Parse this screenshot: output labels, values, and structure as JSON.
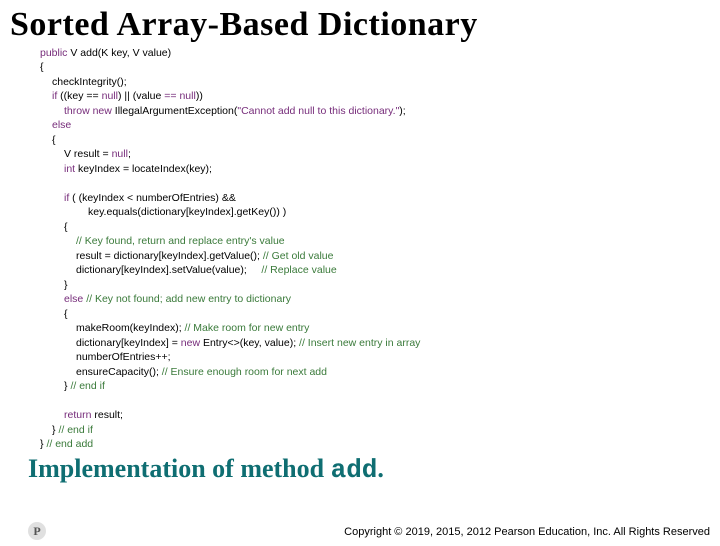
{
  "title": "Sorted Array-Based Dictionary",
  "code": {
    "l1a": "public",
    "l1b": " V add(K key, V value)",
    "l2": "{",
    "l3": "checkIntegrity();",
    "l4a": "if",
    "l4b": " ((key == ",
    "l4c": "null",
    "l4d": ") || (value ",
    "l4e": "==",
    "l4f": " ",
    "l4g": "null",
    "l4h": "))",
    "l5a": "throw new ",
    "l5b": "IllegalArgumentException(",
    "l5c": "\"Cannot add null to this dictionary.\"",
    "l5d": ");",
    "l6": "else",
    "l7": "{",
    "l8a": "V result = ",
    "l8b": "null",
    "l8c": ";",
    "l9a": "int",
    "l9b": " keyIndex = locateIndex(key);",
    "l11a": "if",
    "l11b": " ( (keyIndex < numberOfEntries) && ",
    "l12": "key.equals(dictionary[keyIndex].getKey()) )",
    "l13": "{",
    "l14": "// Key found, return and replace entry's value",
    "l15a": "result = dictionary[keyIndex].getValue(); ",
    "l15b": "// Get old value",
    "l16a": "dictionary[keyIndex].setValue(value);     ",
    "l16b": "// Replace value",
    "l17": "}",
    "l18a": "else",
    "l18b": " ",
    "l18c": "// Key not found; add new entry to dictionary",
    "l19": "{",
    "l20a": "makeRoom(keyIndex); ",
    "l20b": "// Make room for new entry",
    "l21a": "dictionary[keyIndex] = ",
    "l21b": "new",
    "l21c": " Entry<>(key, value); ",
    "l21d": "// Insert new entry in array",
    "l22": "numberOfEntries++;",
    "l23a": "ensureCapacity(); ",
    "l23b": "// Ensure enough room for next add",
    "l24a": "} ",
    "l24b": "// end if",
    "l26a": "return",
    "l26b": " result;",
    "l27a": "} ",
    "l27b": "// end if",
    "l28a": "} ",
    "l28b": "// end add"
  },
  "subtitle_a": "Implementation of method ",
  "subtitle_b": "add",
  "subtitle_c": ".",
  "logo": "P",
  "copyright": "Copyright © 2019, 2015, 2012 Pearson Education, Inc. All Rights Reserved"
}
